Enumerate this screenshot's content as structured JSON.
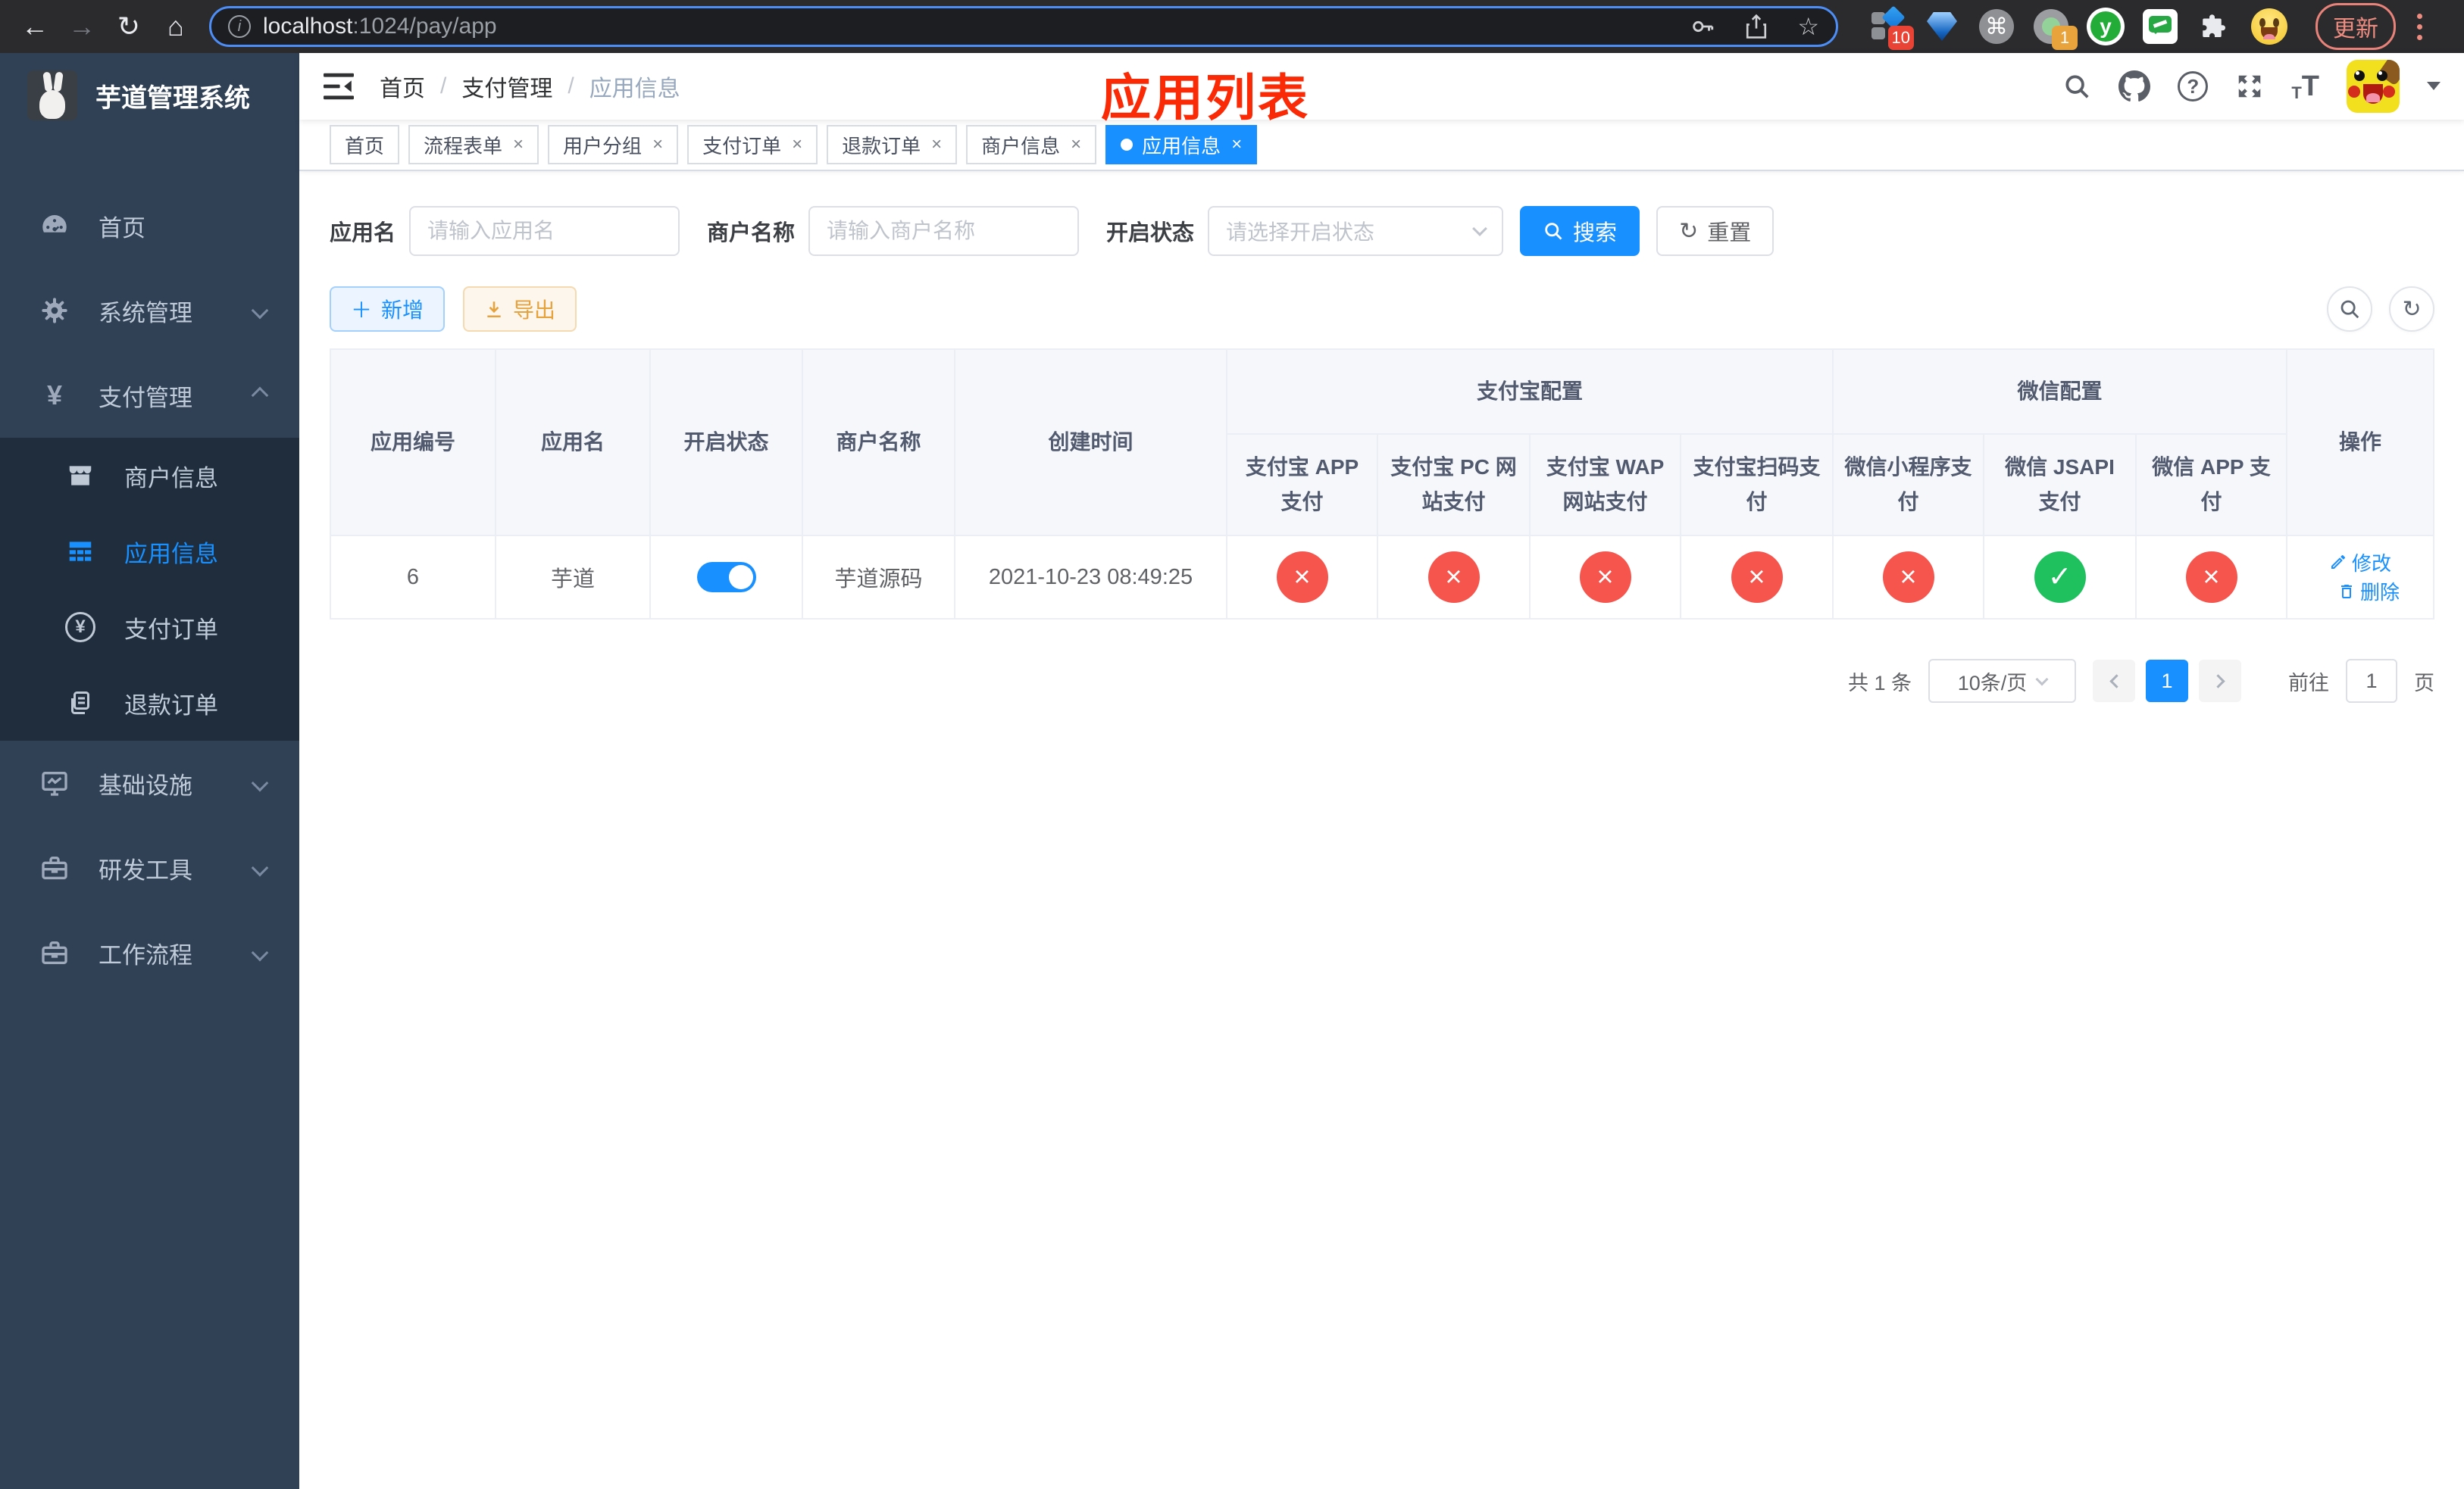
{
  "browser": {
    "url_host": "localhost",
    "url_path": ":1024/pay/app",
    "update_label": "更新",
    "badges": [
      "10",
      "1"
    ],
    "ext_y_letter": "y"
  },
  "icons": {
    "back": "←",
    "forward": "→",
    "reload": "↻",
    "home": "⌂",
    "star": "☆",
    "command": "⌘",
    "close": "×",
    "check": "✓",
    "cross": "×",
    "plus": "＋",
    "question": "?",
    "info": "i",
    "refresh": "↻",
    "yen": "¥",
    "font_small": "T",
    "font_large": "T"
  },
  "sidebar": {
    "title": "芋道管理系统",
    "menu": [
      {
        "label": "首页"
      },
      {
        "label": "系统管理"
      },
      {
        "label": "支付管理"
      },
      {
        "label": "基础设施"
      },
      {
        "label": "研发工具"
      },
      {
        "label": "工作流程"
      }
    ],
    "submenu": [
      {
        "label": "商户信息"
      },
      {
        "label": "应用信息"
      },
      {
        "label": "支付订单"
      },
      {
        "label": "退款订单"
      }
    ]
  },
  "breadcrumb": {
    "items": [
      "首页",
      "支付管理",
      "应用信息"
    ]
  },
  "annotation": {
    "text": "应用列表"
  },
  "tabs": {
    "items": [
      {
        "label": "首页"
      },
      {
        "label": "流程表单"
      },
      {
        "label": "用户分组"
      },
      {
        "label": "支付订单"
      },
      {
        "label": "退款订单"
      },
      {
        "label": "商户信息"
      },
      {
        "label": "应用信息"
      }
    ]
  },
  "filters": {
    "app_name_label": "应用名",
    "app_name_placeholder": "请输入应用名",
    "merchant_label": "商户名称",
    "merchant_placeholder": "请输入商户名称",
    "status_label": "开启状态",
    "status_placeholder": "请选择开启状态",
    "search_label": "搜索",
    "reset_label": "重置"
  },
  "toolbar": {
    "add_label": "新增",
    "export_label": "导出"
  },
  "table": {
    "columns_left": [
      "应用编号",
      "应用名",
      "开启状态",
      "商户名称",
      "创建时间"
    ],
    "groups": [
      {
        "label": "支付宝配置",
        "children": [
          "支付宝 APP 支付",
          "支付宝 PC 网站支付",
          "支付宝 WAP 网站支付",
          "支付宝扫码支付"
        ]
      },
      {
        "label": "微信配置",
        "children": [
          "微信小程序支付",
          "微信 JSAPI 支付",
          "微信 APP 支付"
        ]
      }
    ],
    "action_label": "操作",
    "rows": [
      {
        "id": "6",
        "name": "芋道",
        "enabled": true,
        "merchant": "芋道源码",
        "created": "2021-10-23 08:49:25",
        "configs": [
          "cross",
          "cross",
          "cross",
          "cross",
          "cross",
          "check",
          "cross"
        ],
        "edit_label": "修改",
        "delete_label": "删除"
      }
    ]
  },
  "pagination": {
    "total": "共 1 条",
    "page_size": "10条/页",
    "current_page": "1",
    "goto_label": "前往",
    "goto_value": "1",
    "page_unit": "页"
  },
  "colors": {
    "accent_blue": "#1890ff",
    "danger_red": "#f5554d",
    "success_green": "#1fc15f",
    "warning_orange": "#e6a23c",
    "annotation_red": "#fb2a06",
    "sidebar_bg": "#304156",
    "submenu_bg": "#1f2d3d"
  }
}
